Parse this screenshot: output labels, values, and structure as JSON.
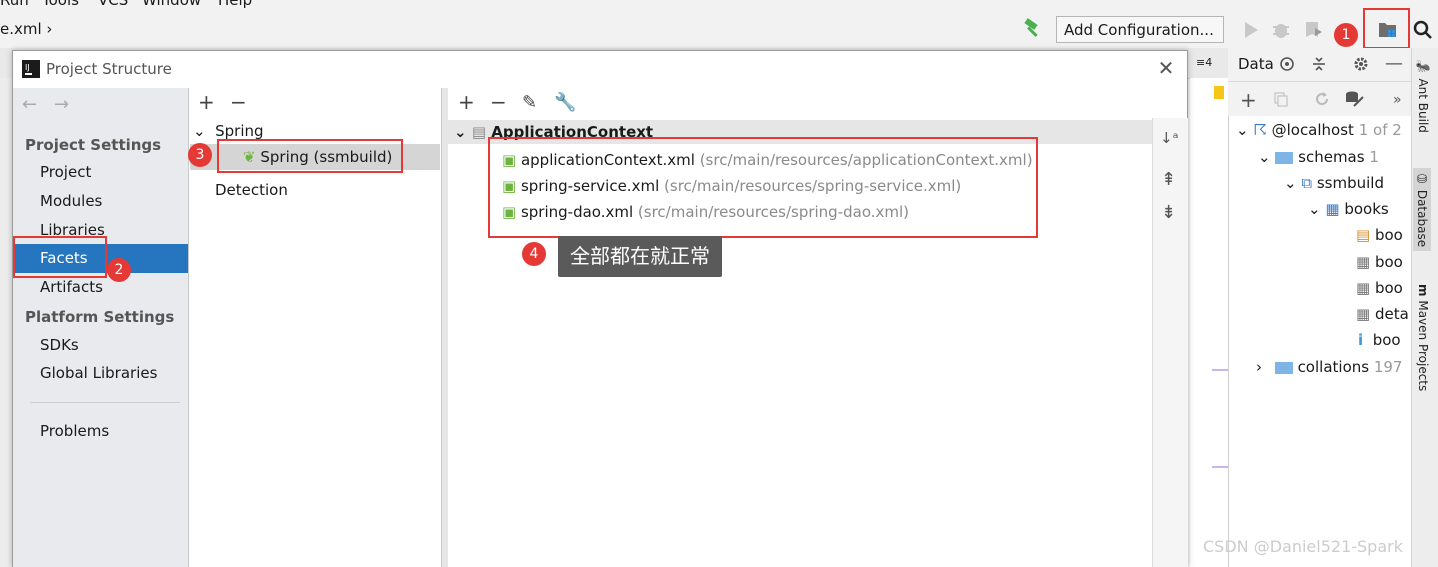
{
  "menu": {
    "items": [
      "Run",
      "Tools",
      "VCS",
      "Window",
      "Help"
    ]
  },
  "toolbar": {
    "breadcrumb": "e.xml",
    "add_configuration": "Add Configuration...",
    "tabs_count": "4"
  },
  "dialog": {
    "title": "Project Structure",
    "nav": {
      "project_settings": "Project Settings",
      "project": "Project",
      "modules": "Modules",
      "libraries": "Libraries",
      "facets": "Facets",
      "artifacts": "Artifacts",
      "platform_settings": "Platform Settings",
      "sdks": "SDKs",
      "global_libraries": "Global Libraries",
      "problems": "Problems"
    },
    "facet_tree": {
      "group": "Spring",
      "selected": "Spring (ssmbuild)",
      "detection": "Detection"
    },
    "context": {
      "header": "ApplicationContext",
      "files": [
        {
          "name": "applicationContext.xml",
          "path": "(src/main/resources/applicationContext.xml)"
        },
        {
          "name": "spring-service.xml",
          "path": "(src/main/resources/spring-service.xml)"
        },
        {
          "name": "spring-dao.xml",
          "path": "(src/main/resources/spring-dao.xml)"
        }
      ]
    }
  },
  "annotations": {
    "badges": [
      "1",
      "2",
      "3",
      "4"
    ],
    "tooltip": "全部都在就正常",
    "highlight_color": "#e53935"
  },
  "database": {
    "title": "Data",
    "host": "@localhost",
    "host_count": "1 of 2",
    "schemas": "schemas",
    "schemas_count": "1",
    "schema": "ssmbuild",
    "table": "books",
    "columns": [
      "boo",
      "boo",
      "boo",
      "deta",
      "boo"
    ],
    "collations": "collations",
    "collations_count": "197"
  },
  "sidebar": {
    "ant_build": "Ant Build",
    "database": "Database",
    "maven": "Maven Projects"
  },
  "watermark": "CSDN @Daniel521-Spark"
}
